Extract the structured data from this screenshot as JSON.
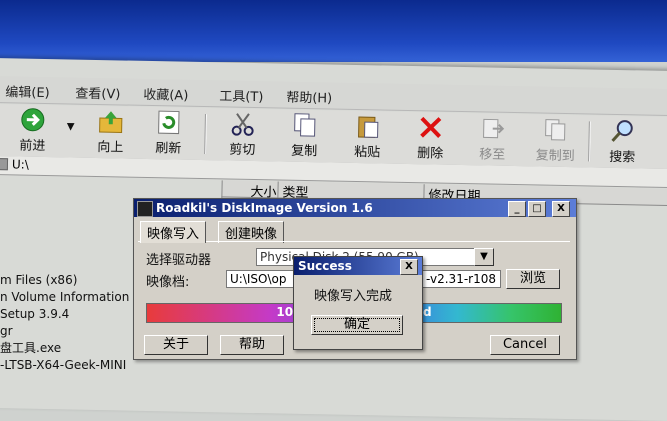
{
  "menu": [
    "编辑(E)",
    "查看(V)",
    "收藏(A)",
    "工具(T)",
    "帮助(H)"
  ],
  "toolbar": {
    "forward": "前进",
    "up": "向上",
    "refresh": "刷新",
    "cut": "剪切",
    "copy": "复制",
    "paste": "粘贴",
    "delete": "删除",
    "move_to": "移至",
    "copy_to": "复制到",
    "search": "搜索"
  },
  "address": "U:\\",
  "list_headers": {
    "size": "大小",
    "type": "类型",
    "modified": "修改日期"
  },
  "files": [
    "m Files (x86)",
    "n Volume Information",
    "Setup 3.9.4",
    "gr",
    "盘工具.exe",
    "-LTSB-X64-Geek-MINI"
  ],
  "diskimage": {
    "title": "Roadkil's DiskImage Version 1.6",
    "tab_write": "映像写入",
    "tab_create": "创建映像",
    "select_drive_label": "选择驱动器",
    "drive_value": "Physical Disk 2 (55.90 GB)",
    "image_file_label": "映像档:",
    "image_path_start": "U:\\ISO\\op",
    "image_path_end": "-v2.31-r108",
    "browse": "浏览",
    "progress_left": "10",
    "progress_right": "d",
    "progress_value": 1.0,
    "about": "关于",
    "help": "帮助",
    "cancel": "Cancel"
  },
  "success": {
    "title": "Success",
    "message": "映像写入完成",
    "ok": "确定",
    "close": "X"
  },
  "window_controls": {
    "min": "_",
    "max": "□",
    "close": "X"
  }
}
